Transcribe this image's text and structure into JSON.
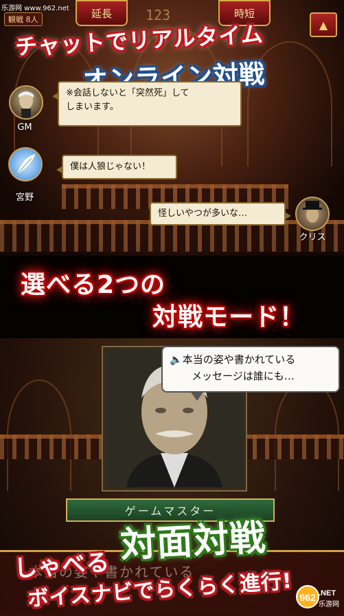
{
  "watermark": "乐游网 www.962.net",
  "hud": {
    "spectators": "観戦 8人",
    "extend_label": "延長",
    "timer": "123",
    "time_label": "時短",
    "collapse_icon": "▲"
  },
  "headline": {
    "line1": "チャットでリアルタイム",
    "line2": "オンライン対戦",
    "line3": "選べる2つの",
    "line4": "対戦モード！",
    "line5": "対面対戦",
    "line6": "しゃべる",
    "line7": "ボイスナビでらくらく進行!"
  },
  "chat": [
    {
      "speaker": "GM",
      "text_line1": "※会話しないと「突然死」して",
      "text_line2": "しまいます。"
    },
    {
      "speaker": "宮野",
      "text_line1": "僕は人狼じゃない！"
    },
    {
      "speaker": "クリス",
      "text_line1": "怪しいやつが多いな…"
    }
  ],
  "face_mode": {
    "speech_line1": "本当の姿や書かれている",
    "speech_line2": "メッセージは誰にも…",
    "speaker_icon": "speaker-icon",
    "name_bar": "ゲームマスター",
    "subtitle_faint": "本当の姿や書かれている"
  },
  "logo": {
    "left": "乐游网",
    "mark": "962",
    "right": ".NET"
  },
  "colors": {
    "red_accent": "#c8141a",
    "gold_border": "#d9a74a",
    "blue_accent": "#1f4f8f",
    "green_accent": "#2c7a1a"
  }
}
